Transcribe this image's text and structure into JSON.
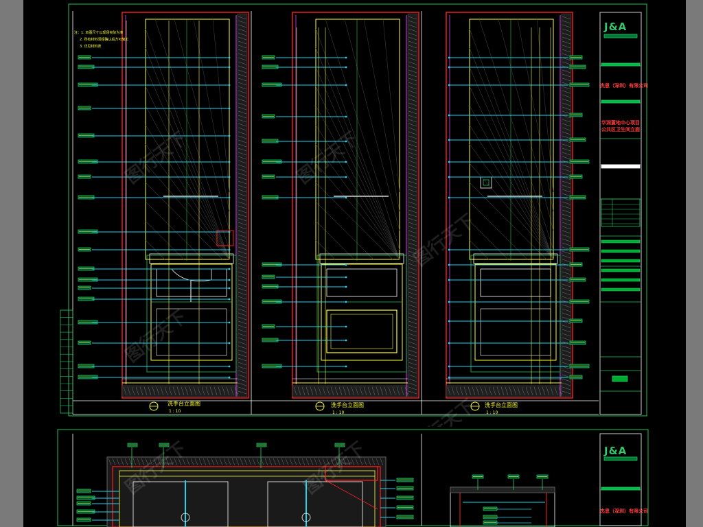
{
  "title_block_top": {
    "logo": "J&A",
    "company_line": "杰恩（深圳）有限公司",
    "project_lines": [
      "华润置地中心项目",
      "公共区卫生间立面"
    ]
  },
  "title_block_bottom": {
    "logo": "J&A",
    "company_line": "杰恩（深圳）有限公司"
  },
  "elevations": [
    {
      "label": "洗手台立面图",
      "scale": "1 : 10"
    },
    {
      "label": "洗手台立面图",
      "scale": "1 : 10"
    },
    {
      "label": "洗手台立面图",
      "scale": "1 : 10"
    }
  ],
  "notes": [
    "注：1. 本图尺寸以现场实际为准",
    "2. 所有材料须经确认后方可施工",
    "3. 详见材料表"
  ],
  "watermark": "图行天下",
  "colors": {
    "background": "#000000",
    "frame": "#22c55e",
    "red": "#ff2020",
    "yellow": "#ffff33",
    "cyan": "#22d3ee",
    "magenta": "#e040fb",
    "white": "#ffffff"
  }
}
